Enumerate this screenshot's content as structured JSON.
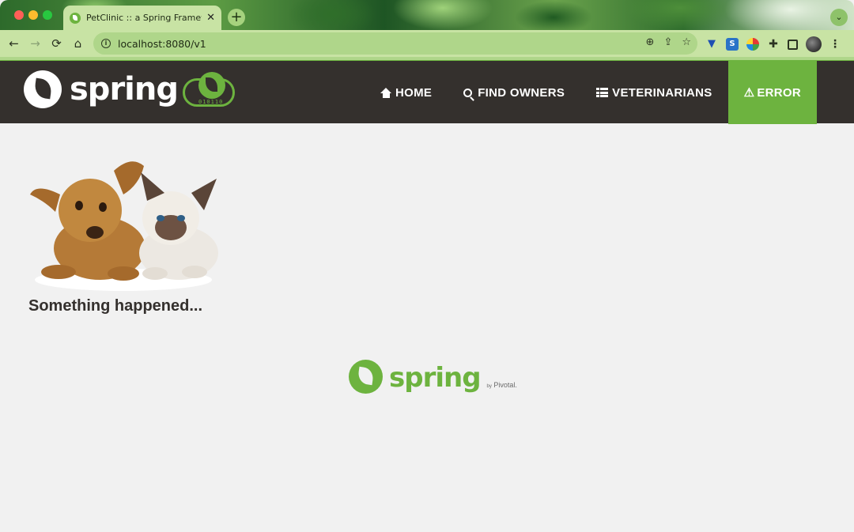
{
  "browser": {
    "tab_title": "PetClinic :: a Spring Framework demo",
    "tab_close": "✕",
    "new_tab": "+",
    "tab_menu": "⌄",
    "url": "localhost:8080/v1",
    "back": "←",
    "forward": "→",
    "reload": "⟳",
    "home": "⌂",
    "zoom_icon": "⊕",
    "share_icon": "⇪",
    "star_icon": "☆"
  },
  "app": {
    "brand": "spring",
    "badge_text": "010110",
    "nav": [
      {
        "label": "HOME",
        "icon": "home-icon"
      },
      {
        "label": "FIND OWNERS",
        "icon": "search-icon"
      },
      {
        "label": "VETERINARIANS",
        "icon": "list-icon"
      },
      {
        "label": "ERROR",
        "icon": "warning-icon",
        "active": true
      }
    ],
    "accent_color": "#6db33f",
    "navbar_color": "#34302d"
  },
  "main": {
    "error_message": "Something happened...",
    "image_alt": "pets"
  },
  "footer": {
    "brand": "spring",
    "by_label": "by",
    "company": "Pivotal."
  }
}
